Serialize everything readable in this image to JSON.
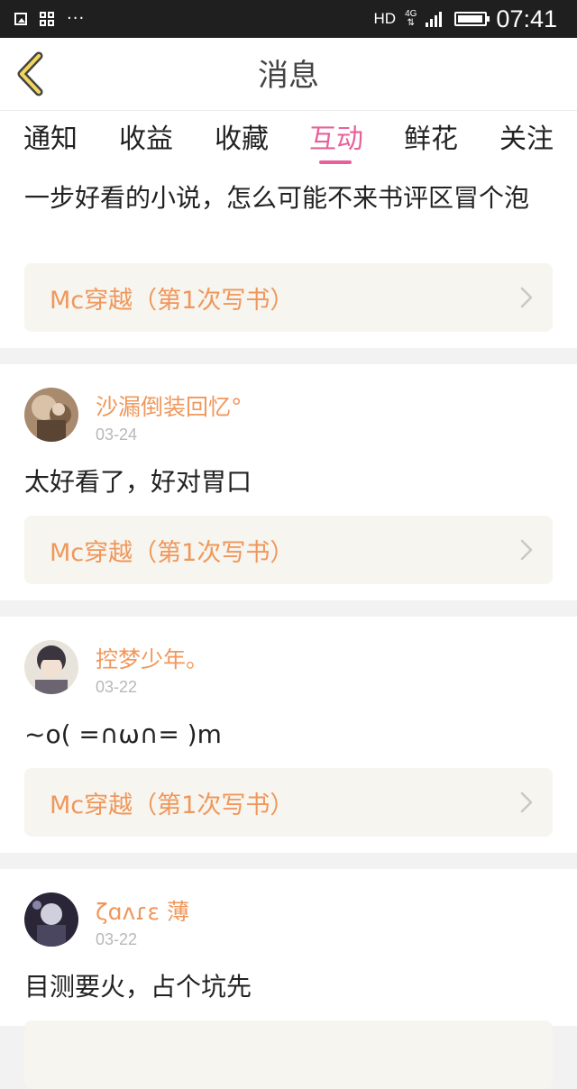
{
  "status_bar": {
    "dots": "···",
    "network": "HD",
    "network_type": "4G",
    "battery_level": 0.95,
    "time": "07:41"
  },
  "header": {
    "title": "消息"
  },
  "tabs": [
    {
      "label": "通知"
    },
    {
      "label": "收益"
    },
    {
      "label": "收藏"
    },
    {
      "label": "互动",
      "active": true
    },
    {
      "label": "鲜花"
    },
    {
      "label": "关注"
    }
  ],
  "colors": {
    "accent": "#e8609a",
    "username": "#f0975b",
    "link_bg": "#f6f5ef"
  },
  "messages": [
    {
      "comment": "一步好看的小说，怎么可能不来书评区冒个泡",
      "book": "Mc穿越（第1次写书）"
    },
    {
      "user": "沙漏倒装回忆°",
      "date": "03-24",
      "comment": "太好看了，好对胃口",
      "book": "Mc穿越（第1次写书）"
    },
    {
      "user": "控梦少年。",
      "date": "03-22",
      "comment": "~o( =∩ω∩= )m",
      "book": "Mc穿越（第1次写书）"
    },
    {
      "user": "ζɑʌɾε 薄",
      "date": "03-22",
      "comment": "目测要火，占个坑先"
    }
  ]
}
